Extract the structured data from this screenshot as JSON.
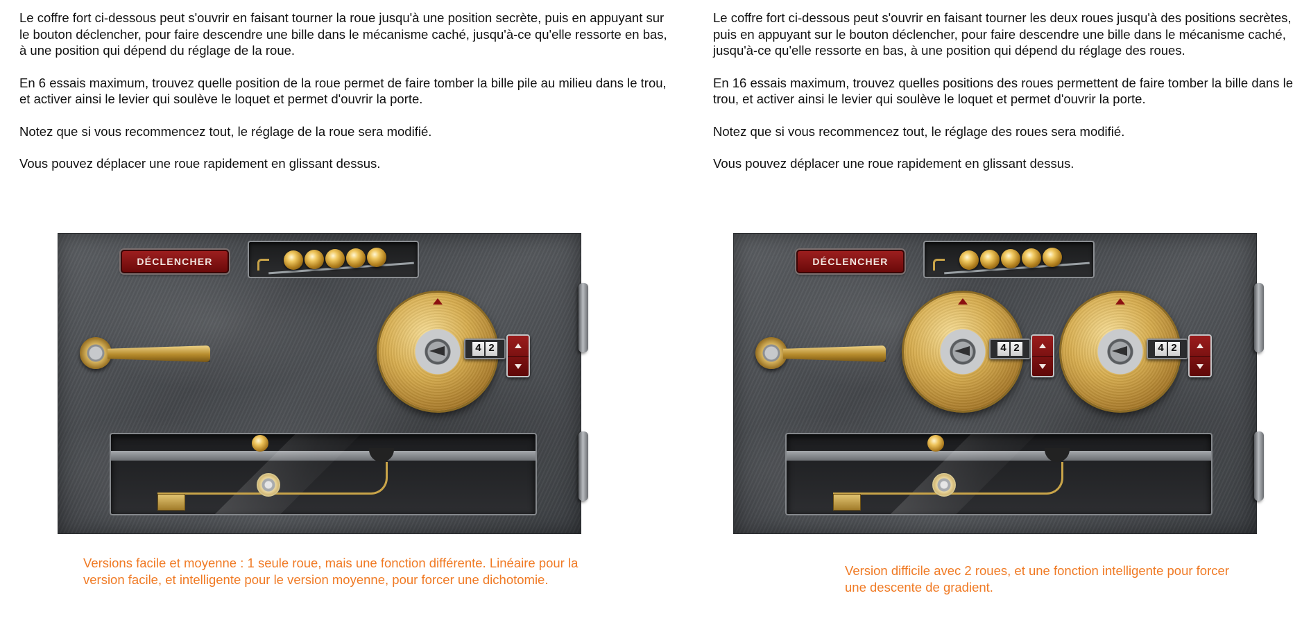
{
  "left": {
    "paragraphs": [
      "Le coffre fort ci-dessous peut s'ouvrir en faisant tourner la roue jusqu'à une position secrète, puis en appuyant sur le bouton déclencher, pour faire descendre une bille dans le mécanisme caché, jusqu'à-ce qu'elle ressorte en bas, à une position qui dépend du réglage de la roue.",
      "En 6 essais maximum, trouvez quelle position de la roue permet de faire tomber la bille pile au milieu dans le trou, et activer ainsi le levier qui soulève le loquet et permet d'ouvrir la porte.",
      "Notez que si vous recommencez tout, le réglage de la roue sera modifié.",
      "Vous pouvez déplacer une roue rapidement en glissant dessus."
    ],
    "caption": "Versions facile et moyenne : 1 seule roue, mais une fonction différente. Linéaire pour la version facile, et intelligente pour le version moyenne, pour forcer une dichotomie.",
    "trigger_label": "DÉCLENCHER",
    "remaining_balls": 5,
    "dials": [
      {
        "counter": [
          "4",
          "2"
        ]
      }
    ]
  },
  "right": {
    "paragraphs": [
      "Le coffre fort ci-dessous peut s'ouvrir en faisant tourner les deux roues jusqu'à des positions secrètes, puis en appuyant sur le bouton déclencher, pour faire descendre une bille dans le mécanisme caché, jusqu'à-ce qu'elle ressorte en bas, à une position qui dépend du réglage des roues.",
      "En 16 essais maximum, trouvez quelles positions des roues permettent de faire tomber la bille dans le trou, et activer ainsi le levier qui soulève le loquet et permet d'ouvrir la porte.",
      "Notez que si vous recommencez tout, le réglage des roues sera modifié.",
      "Vous pouvez déplacer une roue rapidement en glissant dessus."
    ],
    "caption": "Version difficile avec 2 roues, et une fonction intelligente pour forcer une descente de gradient.",
    "trigger_label": "DÉCLENCHER",
    "remaining_balls": 5,
    "dials": [
      {
        "counter": [
          "4",
          "2"
        ]
      },
      {
        "counter": [
          "4",
          "2"
        ]
      }
    ]
  }
}
